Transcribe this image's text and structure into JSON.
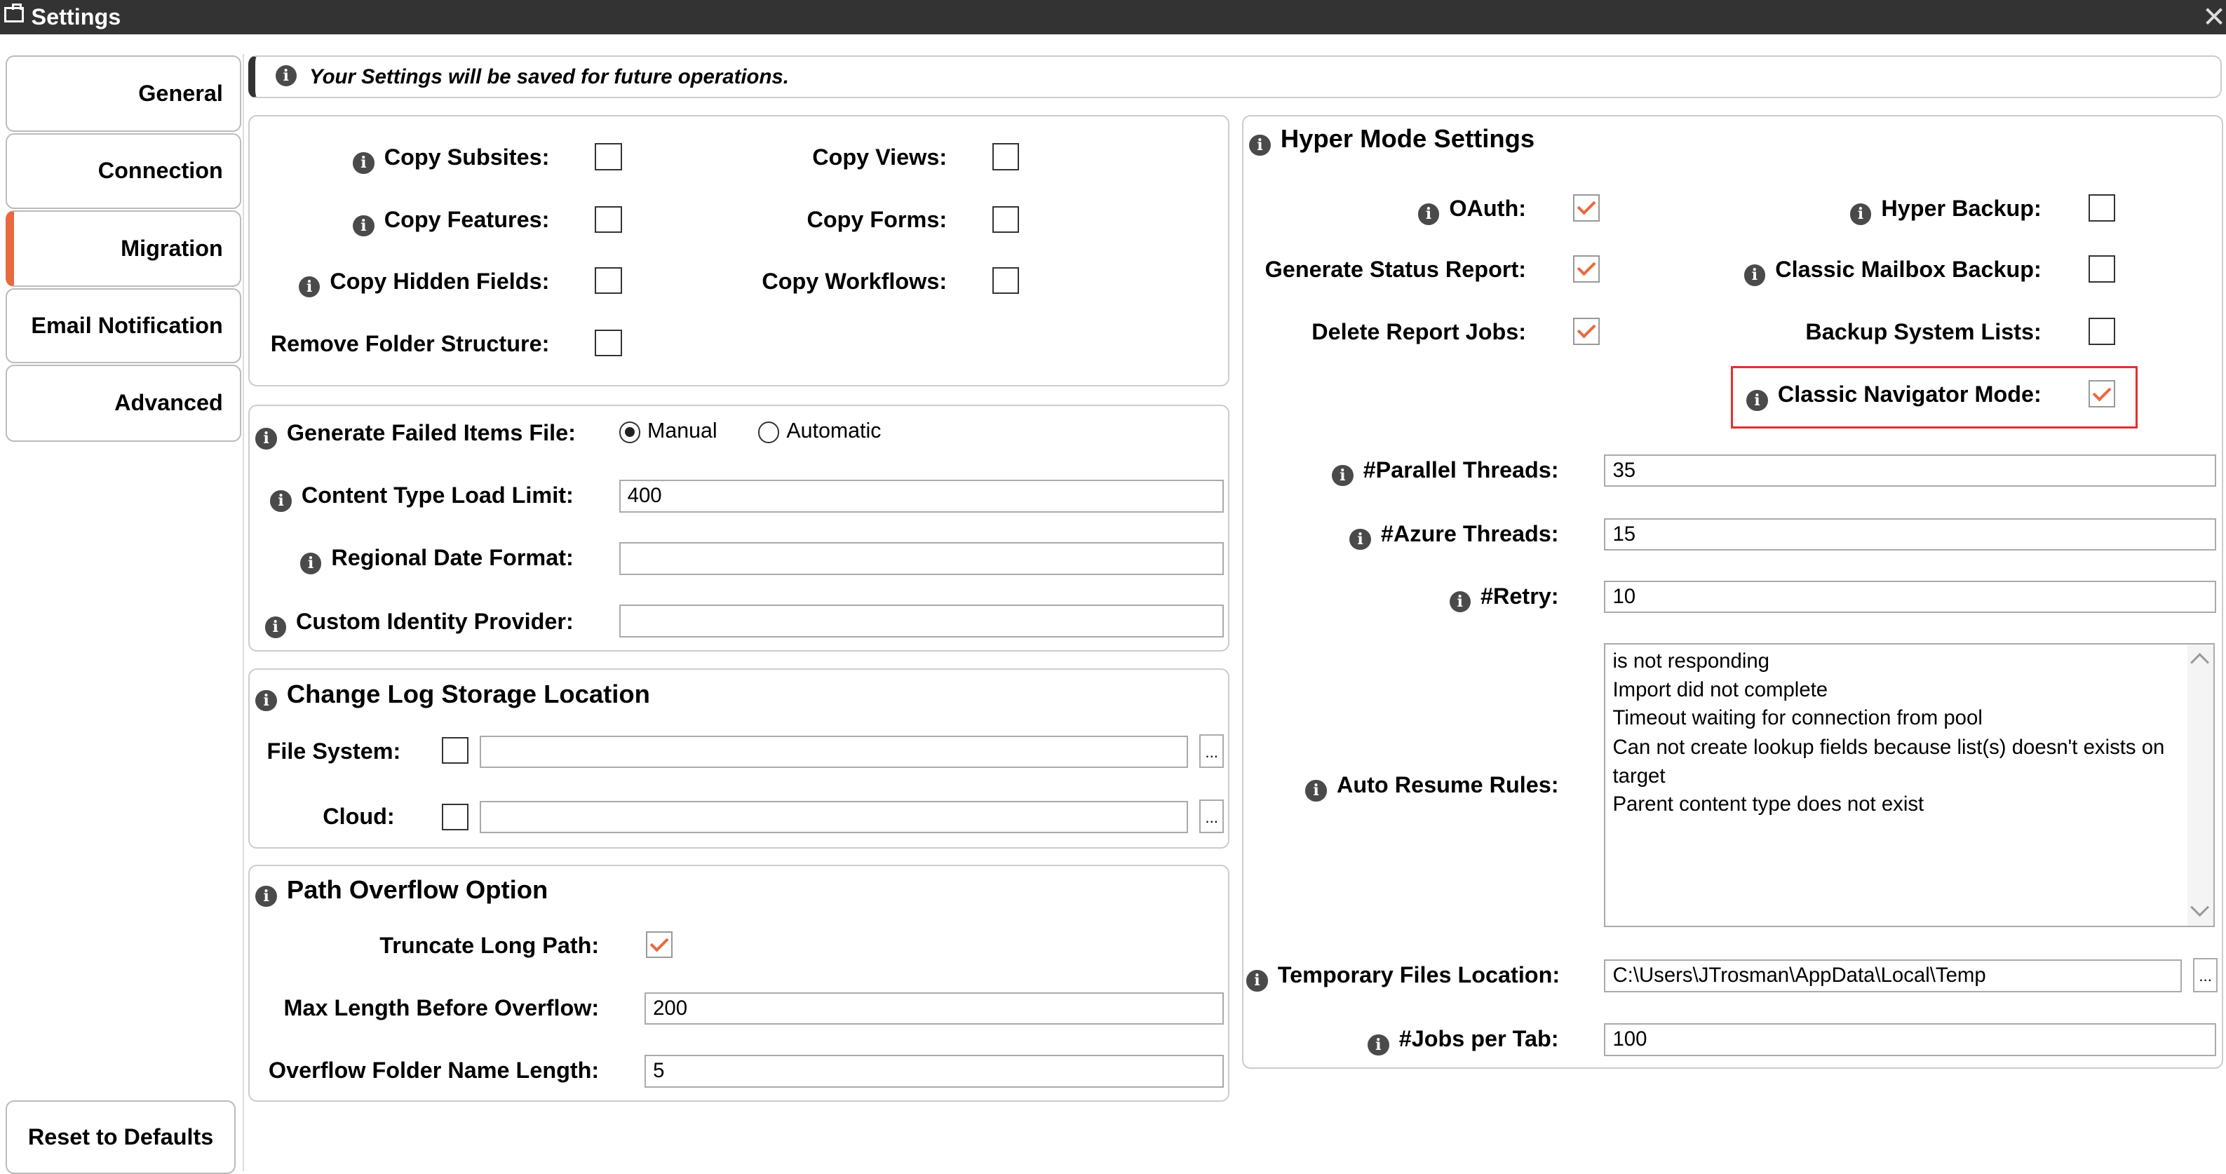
{
  "window": {
    "title": "Settings",
    "icon": "toolbox-icon"
  },
  "sidebar": {
    "items": [
      {
        "label": "General"
      },
      {
        "label": "Connection"
      },
      {
        "label": "Migration",
        "active": true
      },
      {
        "label": "Email Notification"
      },
      {
        "label": "Advanced"
      }
    ],
    "reset_label": "Reset to Defaults"
  },
  "banner": {
    "text": "Your Settings will be saved for future operations."
  },
  "copy_options": {
    "copy_subsites": {
      "label": "Copy Subsites:",
      "checked": false
    },
    "copy_features": {
      "label": "Copy Features:",
      "checked": false
    },
    "copy_hidden_fields": {
      "label": "Copy Hidden Fields:",
      "checked": false
    },
    "remove_folder_structure": {
      "label": "Remove Folder Structure:",
      "checked": false
    },
    "copy_views": {
      "label": "Copy Views:",
      "checked": false
    },
    "copy_forms": {
      "label": "Copy Forms:",
      "checked": false
    },
    "copy_workflows": {
      "label": "Copy Workflows:",
      "checked": false
    }
  },
  "general_fields": {
    "failed_items": {
      "label": "Generate Failed Items File:",
      "options": [
        "Manual",
        "Automatic"
      ],
      "selected": "Manual"
    },
    "content_type_limit": {
      "label": "Content Type Load Limit:",
      "value": "400"
    },
    "regional_date": {
      "label": "Regional Date Format:",
      "value": ""
    },
    "identity_provider": {
      "label": "Custom Identity Provider:",
      "value": ""
    }
  },
  "log_storage": {
    "title": "Change Log Storage Location",
    "file_system": {
      "label": "File System:",
      "checked": false,
      "value": "",
      "browse": "..."
    },
    "cloud": {
      "label": "Cloud:",
      "checked": false,
      "value": "",
      "browse": "..."
    }
  },
  "path_overflow": {
    "title": "Path Overflow Option",
    "truncate": {
      "label": "Truncate Long Path:",
      "checked": true
    },
    "max_length": {
      "label": "Max Length Before Overflow:",
      "value": "200"
    },
    "folder_name_length": {
      "label": "Overflow Folder Name Length:",
      "value": "5"
    }
  },
  "hyper": {
    "title": "Hyper Mode Settings",
    "oauth": {
      "label": "OAuth:",
      "checked": true
    },
    "status_report": {
      "label": "Generate Status Report:",
      "checked": true
    },
    "delete_report_jobs": {
      "label": "Delete Report Jobs:",
      "checked": true
    },
    "hyper_backup": {
      "label": "Hyper Backup:",
      "checked": false
    },
    "classic_mailbox_backup": {
      "label": "Classic Mailbox Backup:",
      "checked": false
    },
    "backup_system_lists": {
      "label": "Backup System Lists:",
      "checked": false
    },
    "classic_navigator": {
      "label": "Classic Navigator Mode:",
      "checked": true,
      "highlighted": true
    },
    "parallel_threads": {
      "label": "#Parallel Threads:",
      "value": "35"
    },
    "azure_threads": {
      "label": "#Azure Threads:",
      "value": "15"
    },
    "retry": {
      "label": "#Retry:",
      "value": "10"
    },
    "auto_resume": {
      "label": "Auto Resume Rules:",
      "lines": [
        "is not responding",
        "Import did not complete",
        "Timeout waiting for connection from pool",
        "Can not create lookup fields because list(s) doesn't exists on",
        "target",
        "Parent content type does not exist"
      ]
    },
    "temp_location": {
      "label": "Temporary Files Location:",
      "value": "C:\\Users\\JTrosman\\AppData\\Local\\Temp",
      "browse": "..."
    },
    "jobs_per_tab": {
      "label": "#Jobs per Tab:",
      "value": "100"
    }
  },
  "colors": {
    "accent": "#e8693f",
    "titlebar": "#333333",
    "highlight": "#e03030"
  }
}
